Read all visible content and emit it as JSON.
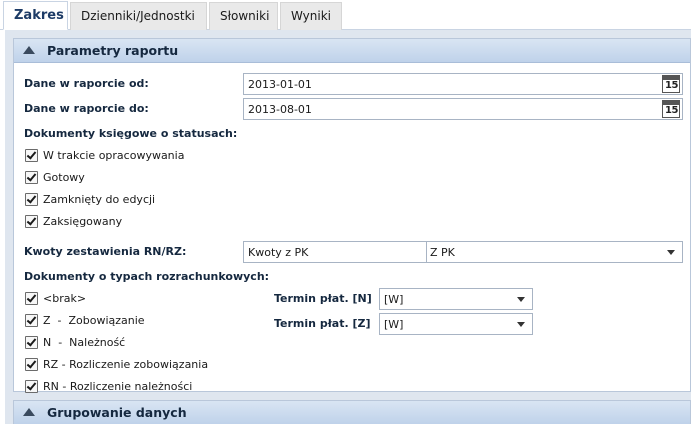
{
  "tabs": [
    {
      "label": "Zakres",
      "active": true
    },
    {
      "label": "Dzienniki/Jednostki",
      "active": false
    },
    {
      "label": "Słowniki",
      "active": false
    },
    {
      "label": "Wyniki",
      "active": false
    }
  ],
  "section_parametry": {
    "title": "Parametry raportu",
    "date_from_label": "Dane w raporcie od:",
    "date_from_value": "2013-01-01",
    "date_to_label": "Dane w raporcie do:",
    "date_to_value": "2013-08-01",
    "calendar_icon_text": "15",
    "statuses_label": "Dokumenty księgowe o statusach:",
    "statuses": [
      {
        "label": "W trakcie opracowywania",
        "checked": true
      },
      {
        "label": "Gotowy",
        "checked": true
      },
      {
        "label": "Zamknięty do edycji",
        "checked": true
      },
      {
        "label": "Zaksięgowany",
        "checked": true
      }
    ],
    "kwoty_label": "Kwoty zestawienia RN/RZ:",
    "kwoty_value": "Kwoty z PK",
    "kwoty_value_2": "Z PK",
    "doc_types_label": "Dokumenty o typach rozrachunkowych:",
    "doc_types": [
      {
        "label": "<brak>",
        "checked": true
      },
      {
        "label": "Z  -  Zobowiązanie",
        "checked": true
      },
      {
        "label": "N  -  Należność",
        "checked": true
      },
      {
        "label": "RZ - Rozliczenie zobowiązania",
        "checked": true
      },
      {
        "label": "RN - Rozliczenie należności",
        "checked": true
      }
    ],
    "termin_n_label": "Termin płat. [N]",
    "termin_n_value": "[W]",
    "termin_z_label": "Termin płat. [Z]",
    "termin_z_value": "[W]"
  },
  "section_grupowanie": {
    "title": "Grupowanie danych"
  }
}
